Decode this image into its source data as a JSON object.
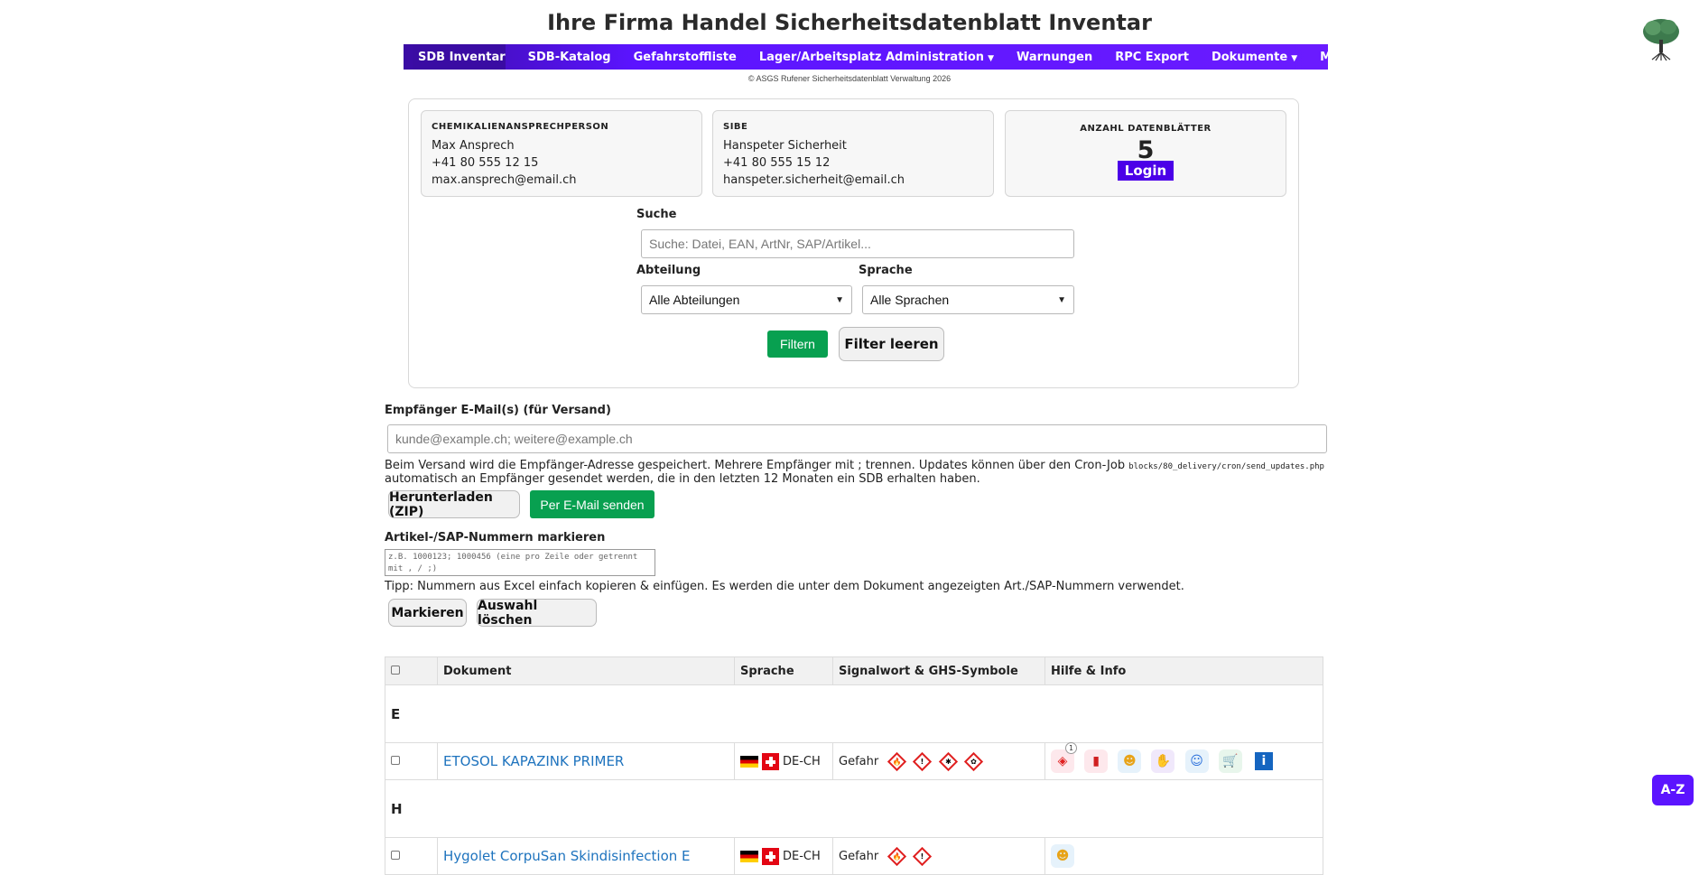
{
  "header": {
    "title": "Ihre Firma Handel Sicherheitsdatenblatt Inventar",
    "copyright": "© ASGS Rufener Sicherheitsdatenblatt Verwaltung 2026"
  },
  "nav": {
    "items": [
      {
        "label": "SDB Inventar",
        "dropdown": false
      },
      {
        "label": "SDB-Katalog",
        "dropdown": false
      },
      {
        "label": "Gefahrstoffliste",
        "dropdown": false
      },
      {
        "label": "Lager/Arbeitsplatz Administration",
        "dropdown": true
      },
      {
        "label": "Warnungen",
        "dropdown": false
      },
      {
        "label": "RPC Export",
        "dropdown": false
      },
      {
        "label": "Dokumente",
        "dropdown": true
      },
      {
        "label": "Meine Daten",
        "dropdown": true
      }
    ]
  },
  "contacts": {
    "chem": {
      "label": "CHEMIKALIENANSPRECHPERSON",
      "name": "Max Ansprech",
      "phone": "+41 80 555 12 15",
      "email": "max.ansprech@email.ch"
    },
    "sibe": {
      "label": "SIBE",
      "name": "Hanspeter Sicherheit",
      "phone": "+41 80 555 15 12",
      "email": "hanspeter.sicherheit@email.ch"
    },
    "count": {
      "label": "ANZAHL DATENBLÄTTER",
      "value": "5",
      "login": "Login"
    }
  },
  "filter": {
    "search_label": "Suche",
    "search_placeholder": "Suche: Datei, EAN, ArtNr, SAP/Artikel...",
    "department_label": "Abteilung",
    "department_value": "Alle Abteilungen",
    "language_label": "Sprache",
    "language_value": "Alle Sprachen",
    "filter_btn": "Filtern",
    "clear_btn": "Filter leeren"
  },
  "email": {
    "label": "Empfänger E-Mail(s) (für Versand)",
    "placeholder": "kunde@example.ch; weitere@example.ch",
    "help_line1": "Beim Versand wird die Empfänger-Adresse gespeichert. Mehrere Empfänger mit ; trennen. Updates können über den Cron-Job",
    "cron_path": "blocks/80_delivery/cron/send_updates.php",
    "help_line2": "automatisch an Empfänger gesendet werden, die in den letzten 12 Monaten ein SDB erhalten haben.",
    "download_btn": "Herunterladen (ZIP)",
    "send_btn": "Per E-Mail senden"
  },
  "mark": {
    "label": "Artikel-/SAP-Nummern markieren",
    "placeholder": "z.B. 1000123; 1000456 (eine pro Zeile oder getrennt mit , / ;)",
    "tip": "Tipp: Nummern aus Excel einfach kopieren & einfügen. Es werden die unter dem Dokument angezeigten Art./SAP-Nummern verwendet.",
    "mark_btn": "Markieren",
    "clear_btn": "Auswahl löschen"
  },
  "table": {
    "headers": [
      "Dokument",
      "Sprache",
      "Signalwort & GHS-Symbole",
      "Hilfe & Info"
    ],
    "groups": [
      {
        "letter": "E",
        "rows": [
          {
            "document": "ETOSOL KAPAZINK PRIMER",
            "language": "DE-CH",
            "signal": "Gefahr",
            "ghs_icons": [
              "flame-icon",
              "exclamation-icon",
              "health-hazard-icon",
              "environment-icon"
            ],
            "help_badge": "1"
          }
        ]
      },
      {
        "letter": "H",
        "rows": [
          {
            "document": "Hygolet CorpuSan Skindisinfection E",
            "language": "DE-CH",
            "signal": "Gefahr",
            "ghs_icons": [
              "flame-icon",
              "exclamation-icon"
            ]
          }
        ]
      }
    ]
  },
  "az_button": "A-Z",
  "colors": {
    "nav": "#5b14ff",
    "green": "#08a050",
    "link": "#1e73be"
  }
}
